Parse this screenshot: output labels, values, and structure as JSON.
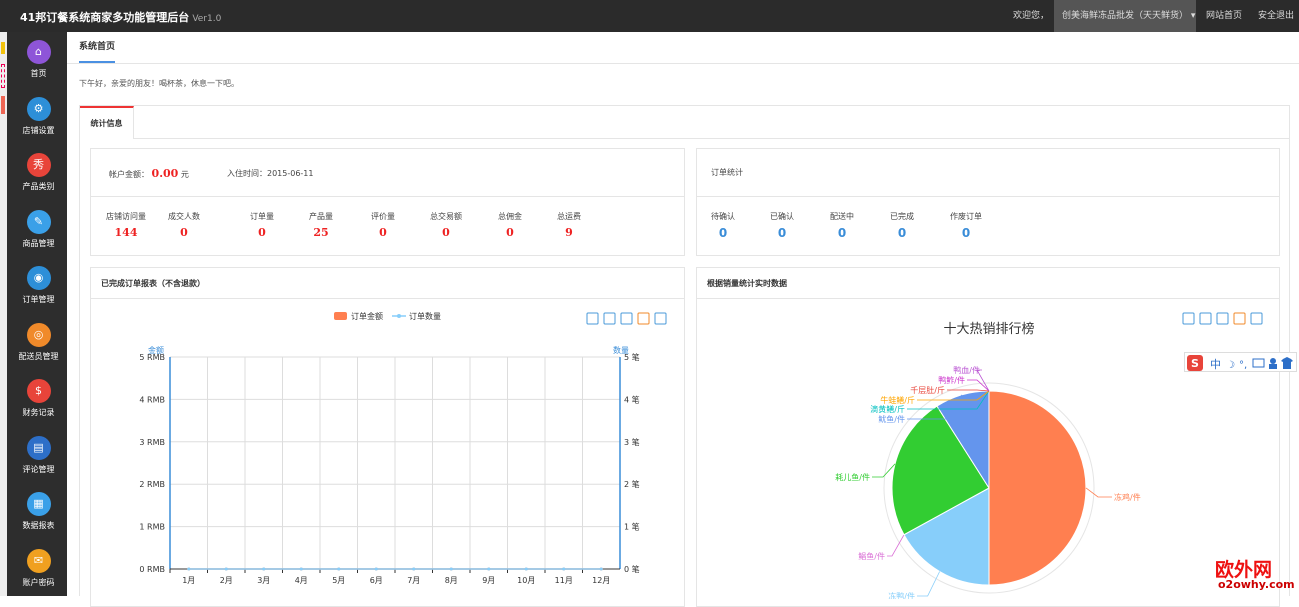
{
  "topbar": {
    "title": "41邦订餐系统商家多功能管理后台",
    "version": "Ver1.0",
    "welcome": "欢迎您，",
    "shop": "创美海鲜冻品批发（天天鲜货）",
    "caret": "▾",
    "home_link": "网站首页",
    "logout": "安全退出"
  },
  "sidebar": {
    "items": [
      {
        "label": "首页",
        "icon": "home-icon",
        "glyph": "⌂",
        "color": "#8e55d8"
      },
      {
        "label": "店铺设置",
        "icon": "link-icon",
        "glyph": "⚙",
        "color": "#2d8fd8"
      },
      {
        "label": "产品类别",
        "icon": "show-icon",
        "glyph": "秀",
        "color": "#e8443a"
      },
      {
        "label": "商品管理",
        "icon": "edit-icon",
        "glyph": "✎",
        "color": "#3aa0e8"
      },
      {
        "label": "订单管理",
        "icon": "compass-icon",
        "glyph": "◉",
        "color": "#2d8fd8"
      },
      {
        "label": "配送员管理",
        "icon": "broadcast-icon",
        "glyph": "◎",
        "color": "#f08a2a"
      },
      {
        "label": "财务记录",
        "icon": "dollar-icon",
        "glyph": "$",
        "color": "#e8443a"
      },
      {
        "label": "评论管理",
        "icon": "chat-icon",
        "glyph": "▤",
        "color": "#2d6fc8"
      },
      {
        "label": "数据报表",
        "icon": "chart-icon",
        "glyph": "▦",
        "color": "#3aa0e8"
      },
      {
        "label": "账户密码",
        "icon": "lock-icon",
        "glyph": "✉",
        "color": "#f0a020"
      }
    ]
  },
  "main": {
    "tab": "系统首页",
    "greeting": "下午好，亲爱的朋友！喝杯茶，休息一下吧。",
    "panel_tab": "统计信息"
  },
  "account": {
    "balance_label": "帐户金额：",
    "balance": "0.00",
    "unit": "元",
    "join_label": "入住时间：2015-06-11",
    "stats": [
      {
        "label": "店铺访问量",
        "value": "144"
      },
      {
        "label": "成交人数",
        "value": "0"
      },
      {
        "label": "订单量",
        "value": "0"
      },
      {
        "label": "产品量",
        "value": "25"
      },
      {
        "label": "评价量",
        "value": "0"
      },
      {
        "label": "总交易额",
        "value": "0"
      },
      {
        "label": "总佣金",
        "value": "0"
      },
      {
        "label": "总运费",
        "value": "9"
      }
    ]
  },
  "orders": {
    "title": "订单统计",
    "stats": [
      {
        "label": "待确认",
        "value": "0"
      },
      {
        "label": "已确认",
        "value": "0"
      },
      {
        "label": "配送中",
        "value": "0"
      },
      {
        "label": "已完成",
        "value": "0"
      },
      {
        "label": "作废订单",
        "value": "0"
      }
    ]
  },
  "line_box": {
    "title": "已完成订单报表（不含退款）"
  },
  "pie_box": {
    "title": "根据销量统计实时数据"
  },
  "colors": {
    "accent": "#4a90e2",
    "red": "#e22222",
    "blue": "#3a8dd8"
  },
  "chart_data": [
    {
      "type": "line",
      "categories": [
        "1月",
        "2月",
        "3月",
        "4月",
        "5月",
        "6月",
        "7月",
        "8月",
        "9月",
        "10月",
        "11月",
        "12月"
      ],
      "series": [
        {
          "name": "订单金额",
          "values": [
            0,
            0,
            0,
            0,
            0,
            0,
            0,
            0,
            0,
            0,
            0,
            0
          ],
          "color": "#ff7f50"
        },
        {
          "name": "订单数量",
          "values": [
            0,
            0,
            0,
            0,
            0,
            0,
            0,
            0,
            0,
            0,
            0,
            0
          ],
          "color": "#87cefa"
        }
      ],
      "ylabel": "金额",
      "ylabel2": "数量",
      "ylim": [
        0,
        5
      ],
      "y_ticks": [
        "0 RMB",
        "1 RMB",
        "2 RMB",
        "3 RMB",
        "4 RMB",
        "5 RMB"
      ],
      "y2_ticks": [
        "0 笔",
        "1 笔",
        "2 笔",
        "3 笔",
        "4 笔",
        "5 笔"
      ],
      "grid": true,
      "legend": "top-center"
    },
    {
      "type": "pie",
      "title": "十大热销排行榜",
      "slices": [
        {
          "label": "冻鸡/件",
          "value": 50,
          "color": "#ff7f50"
        },
        {
          "label": "冻鸭/件",
          "value": 17,
          "color": "#87cefa"
        },
        {
          "label": "鲳鱼/件",
          "value": 0.001,
          "color": "#da70d6"
        },
        {
          "label": "耗儿鱼/件",
          "value": 24,
          "color": "#32cd32"
        },
        {
          "label": "鱿鱼/件",
          "value": 9,
          "color": "#6495ed"
        },
        {
          "label": "滴黄鳝/斤",
          "value": 0.001,
          "color": "#00c0c0"
        },
        {
          "label": "牛蛙鳝/斤",
          "value": 0.001,
          "color": "#ffa500"
        },
        {
          "label": "千层肚/斤",
          "value": 0.001,
          "color": "#e8443a"
        },
        {
          "label": "鸭鲊/件",
          "value": 0.001,
          "color": "#cc33cc"
        },
        {
          "label": "鸭血/件",
          "value": 0.001,
          "color": "#ba55d3"
        }
      ],
      "legend": "none"
    }
  ],
  "watermark": {
    "big": "欧外网",
    "small": "o2owhy.com"
  }
}
